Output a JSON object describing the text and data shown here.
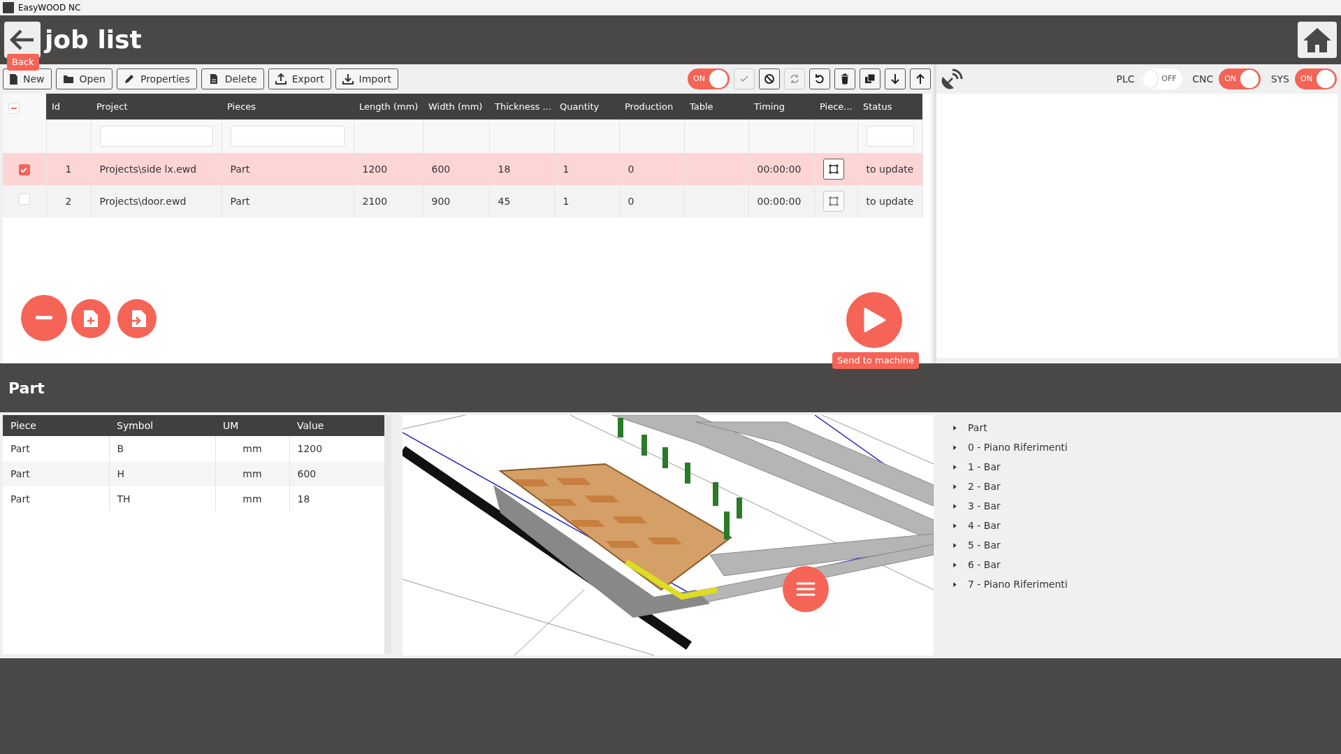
{
  "window": {
    "title": "EasyWOOD NC"
  },
  "header": {
    "title": "job list",
    "back_tooltip": "Back"
  },
  "toolbar": {
    "buttons": [
      {
        "label": "New"
      },
      {
        "label": "Open"
      },
      {
        "label": "Properties"
      },
      {
        "label": "Delete"
      },
      {
        "label": "Export"
      },
      {
        "label": "Import"
      }
    ],
    "main_toggle": {
      "label": "ON",
      "on": true
    },
    "icon_buttons": [
      {
        "disabled": true
      },
      {
        "disabled": false
      },
      {
        "disabled": true
      },
      {
        "disabled": false
      },
      {
        "disabled": false
      },
      {
        "disabled": false
      },
      {
        "disabled": false
      },
      {
        "disabled": false
      }
    ]
  },
  "status_toggles": [
    {
      "label": "PLC",
      "state_text": "OFF",
      "on": false
    },
    {
      "label": "CNC",
      "state_text": "ON",
      "on": true
    },
    {
      "label": "SYS",
      "state_text": "ON",
      "on": true
    }
  ],
  "jobs": {
    "header_checkbox": {
      "indeterminate": true
    },
    "columns": [
      {
        "label": "Id",
        "kind": "center",
        "filter": false
      },
      {
        "label": "Project",
        "kind": "text",
        "filter": true
      },
      {
        "label": "Pieces",
        "kind": "text",
        "filter": true
      },
      {
        "label": "Length (mm)",
        "kind": "text",
        "filter": false
      },
      {
        "label": "Width (mm)",
        "kind": "text",
        "filter": false
      },
      {
        "label": "Thickness ...",
        "kind": "text",
        "filter": false
      },
      {
        "label": "Quantity",
        "kind": "text",
        "filter": false
      },
      {
        "label": "Production",
        "kind": "text",
        "filter": false
      },
      {
        "label": "Table",
        "kind": "text",
        "filter": false
      },
      {
        "label": "Timing",
        "kind": "text",
        "filter": false
      },
      {
        "label": "Piece...",
        "kind": "button",
        "filter": false
      },
      {
        "label": "Status",
        "kind": "text",
        "filter": true
      }
    ],
    "rows": [
      {
        "selected": true,
        "checked": true,
        "cells": [
          "1",
          "Projects\\side lx.ewd",
          "Part",
          "1200",
          "600",
          "18",
          "1",
          "0",
          null,
          "00:00:00",
          null,
          "to update"
        ]
      },
      {
        "selected": false,
        "checked": false,
        "cells": [
          "2",
          "Projects\\door.ewd",
          "Part",
          "2100",
          "900",
          "45",
          "1",
          "0",
          null,
          "00:00:00",
          null,
          "to update"
        ]
      }
    ]
  },
  "send_tooltip": "Send to machine",
  "detail": {
    "title": "Part",
    "columns": [
      "Piece",
      "Symbol",
      "UM",
      "Value"
    ],
    "rows": [
      [
        "Part",
        "B",
        "mm",
        "1200"
      ],
      [
        "Part",
        "H",
        "mm",
        "600"
      ],
      [
        "Part",
        "TH",
        "mm",
        "18"
      ]
    ]
  },
  "tree": [
    {
      "label": "Part",
      "expanded": false
    },
    {
      "label": "0 - Piano Riferimenti",
      "expanded": false
    },
    {
      "label": "1 - Bar",
      "expanded": false
    },
    {
      "label": "2 - Bar",
      "expanded": false
    },
    {
      "label": "3 - Bar",
      "expanded": false
    },
    {
      "label": "4 - Bar",
      "expanded": false
    },
    {
      "label": "5 - Bar",
      "expanded": false
    },
    {
      "label": "6 - Bar",
      "expanded": false
    },
    {
      "label": "7 - Piano Riferimenti",
      "expanded": false
    }
  ]
}
